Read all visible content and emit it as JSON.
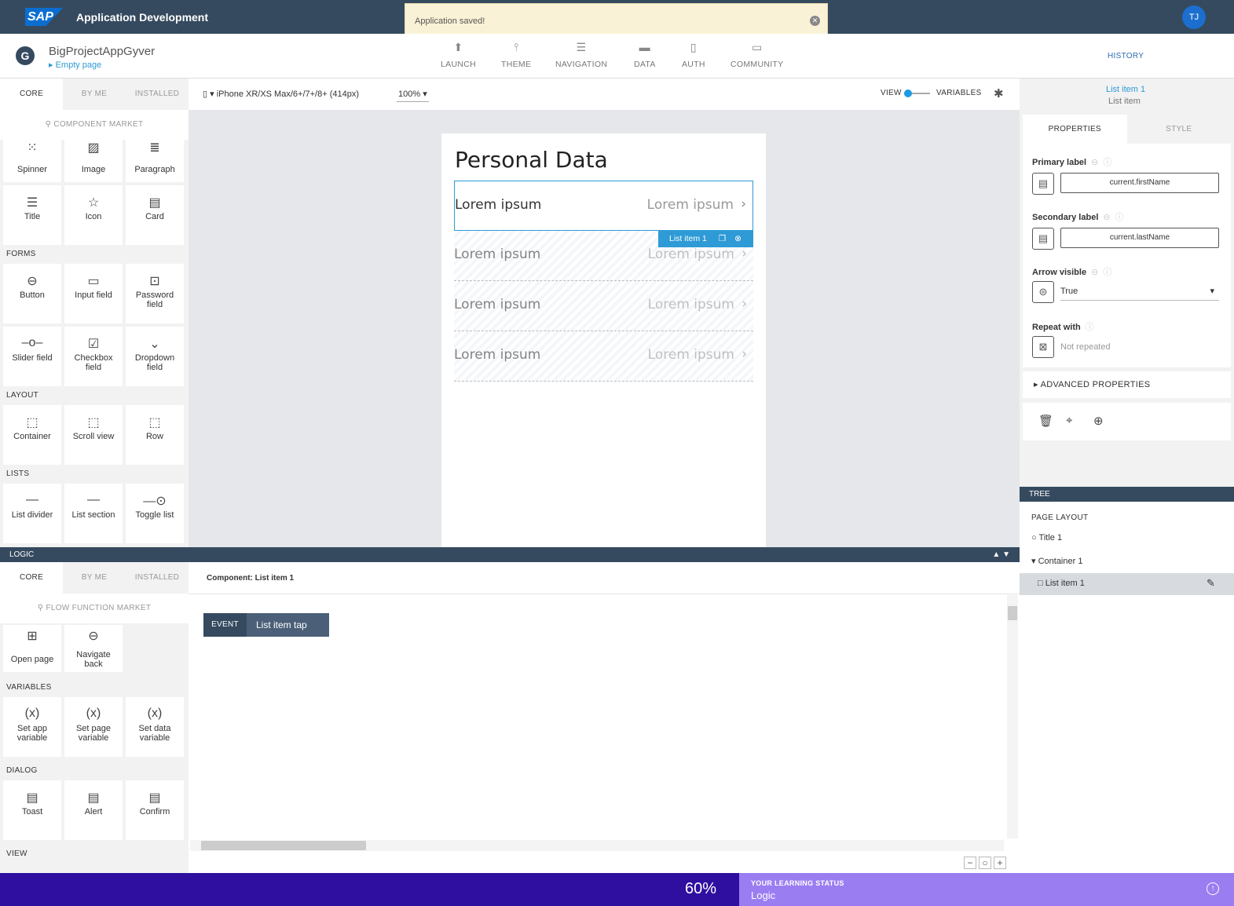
{
  "topbar": {
    "brand": "SAP",
    "title": "Application Development",
    "avatar": "TJ"
  },
  "toast": {
    "message": "Application saved!"
  },
  "project": {
    "name": "BigProjectAppGyver",
    "page": "Empty page"
  },
  "nav": {
    "items": [
      "LAUNCH",
      "THEME",
      "NAVIGATION",
      "DATA",
      "AUTH",
      "COMMUNITY"
    ],
    "history": "HISTORY"
  },
  "components": {
    "tabs": [
      "CORE",
      "BY ME",
      "INSTALLED"
    ],
    "market": "COMPONENT MARKET",
    "top": [
      "Spinner",
      "Image",
      "Paragraph",
      "Title",
      "Icon",
      "Card"
    ],
    "forms_title": "FORMS",
    "forms": [
      "Button",
      "Input field",
      "Password field",
      "Slider field",
      "Checkbox field",
      "Dropdown field"
    ],
    "layout_title": "LAYOUT",
    "layout": [
      "Container",
      "Scroll view",
      "Row"
    ],
    "lists_title": "LISTS",
    "lists": [
      "List divider",
      "List section",
      "Toggle list"
    ]
  },
  "canvas": {
    "device": "iPhone XR/XS Max/6+/7+/8+ (414px)",
    "zoom": "100%",
    "view": "VIEW",
    "variables": "VARIABLES",
    "page_title": "Personal Data",
    "items": [
      {
        "primary": "Lorem ipsum",
        "secondary": "Lorem ipsum"
      },
      {
        "primary": "Lorem ipsum",
        "secondary": "Lorem ipsum"
      },
      {
        "primary": "Lorem ipsum",
        "secondary": "Lorem ipsum"
      },
      {
        "primary": "Lorem ipsum",
        "secondary": "Lorem ipsum"
      }
    ],
    "selected_chip": "List item 1"
  },
  "properties": {
    "selected_name": "List item 1",
    "selected_type": "List item",
    "tabs": [
      "PROPERTIES",
      "STYLE"
    ],
    "primary_label": "Primary label",
    "primary_value": "current.firstName",
    "secondary_label": "Secondary label",
    "secondary_value": "current.lastName",
    "arrow_label": "Arrow visible",
    "arrow_value": "True",
    "repeat_label": "Repeat with",
    "repeat_value": "Not repeated",
    "advanced": "ADVANCED PROPERTIES"
  },
  "tree": {
    "title": "TREE",
    "root": "PAGE LAYOUT",
    "nodes": [
      "Title 1",
      "Container 1",
      "List item 1"
    ]
  },
  "logic": {
    "title": "LOGIC",
    "tabs": [
      "CORE",
      "BY ME",
      "INSTALLED"
    ],
    "market": "FLOW FUNCTION MARKET",
    "nav_items": [
      "Open page",
      "Navigate back"
    ],
    "variables_title": "VARIABLES",
    "variables": [
      "Set app variable",
      "Set page variable",
      "Set data variable"
    ],
    "dialog_title": "DIALOG",
    "dialog": [
      "Toast",
      "Alert",
      "Confirm"
    ],
    "view_title": "VIEW",
    "component_label": "Component: List item 1",
    "event_key": "EVENT",
    "event_value": "List item tap"
  },
  "learning": {
    "percent": "60%",
    "title": "YOUR LEARNING STATUS",
    "value": "Logic"
  }
}
